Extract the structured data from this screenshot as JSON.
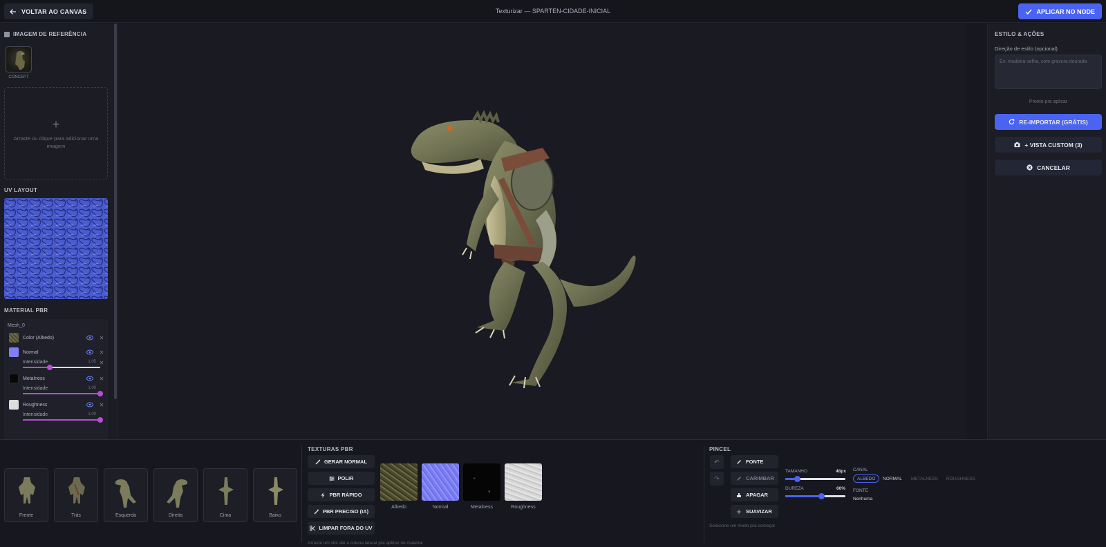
{
  "header": {
    "back_label": "VOLTAR AO CANVAS",
    "title": "Texturizar — SPARTEN-CIDADE-INICIAL",
    "apply_label": "APLICAR NO NODE"
  },
  "left_panel": {
    "reference_title": "IMAGEM DE REFERÊNCIA",
    "concept_label": "CONCEPT",
    "dropzone_plus": "+",
    "dropzone_text": "Arraste ou clique para adicionar uma imagem",
    "uv_title": "UV LAYOUT",
    "material_title": "MATERIAL PBR",
    "mesh_name": "Mesh_0",
    "materials": [
      {
        "name": "Color (Albedo)",
        "color": "#5a5a3a"
      },
      {
        "name": "Normal",
        "color": "#8080ff",
        "intensity_label": "Intensidade",
        "intensity_text": "1.05",
        "intensity": 0.35
      },
      {
        "name": "Metalness",
        "color": "#0a0a0a",
        "intensity_label": "Intensidade",
        "intensity_text": "1.00",
        "intensity": 1.0
      },
      {
        "name": "Roughness",
        "color": "#d9d9d9",
        "intensity_label": "Intensidade",
        "intensity_text": "1.00",
        "intensity": 1.0
      }
    ]
  },
  "right_panel": {
    "title": "ESTILO & AÇÕES",
    "style_label": "Direção de estilo (opcional)",
    "style_placeholder": "Ex: madeira velha, com gravura dourada",
    "status": "Pronto pra aplicar",
    "reimport_label": "RE-IMPORTAR (GRÁTIS)",
    "custom_view_label": "+ VISTA CUSTOM (3)",
    "cancel_label": "CANCELAR"
  },
  "views": [
    "Frente",
    "Trás",
    "Esquerda",
    "Direita",
    "Cima",
    "Baixo"
  ],
  "textures": {
    "title": "TEXTURAS PBR",
    "buttons": [
      "GERAR NORMAL",
      "POLIR",
      "PBR RÁPIDO",
      "PBR PRECISO (IA)",
      "LIMPAR FORA DO UV"
    ],
    "maps": [
      "Albedo",
      "Normal",
      "Metalness",
      "Roughness"
    ],
    "hint": "Arraste um slot até a coluna lateral pra aplicar no material"
  },
  "brush": {
    "title": "PINCEL",
    "modes": [
      "FONTE",
      "CARIMBAR",
      "APAGAR",
      "SUAVIZAR"
    ],
    "size_label": "TAMANHO",
    "size_value": "48px",
    "size_fraction": 0.2,
    "hardness_label": "DUREZA",
    "hardness_value": "60%",
    "hardness_fraction": 0.6,
    "channel_label": "CANAL",
    "channels": [
      "ALBEDO",
      "NORMAL",
      "METALNESS",
      "ROUGHNESS"
    ],
    "source_label": "FONTE",
    "source_value": "Nenhuma",
    "hint": "Selecione um modo pra começar"
  },
  "colors": {
    "accent": "#4a63f0",
    "slider_purple": "#b84dd6",
    "background": "#17181f"
  }
}
